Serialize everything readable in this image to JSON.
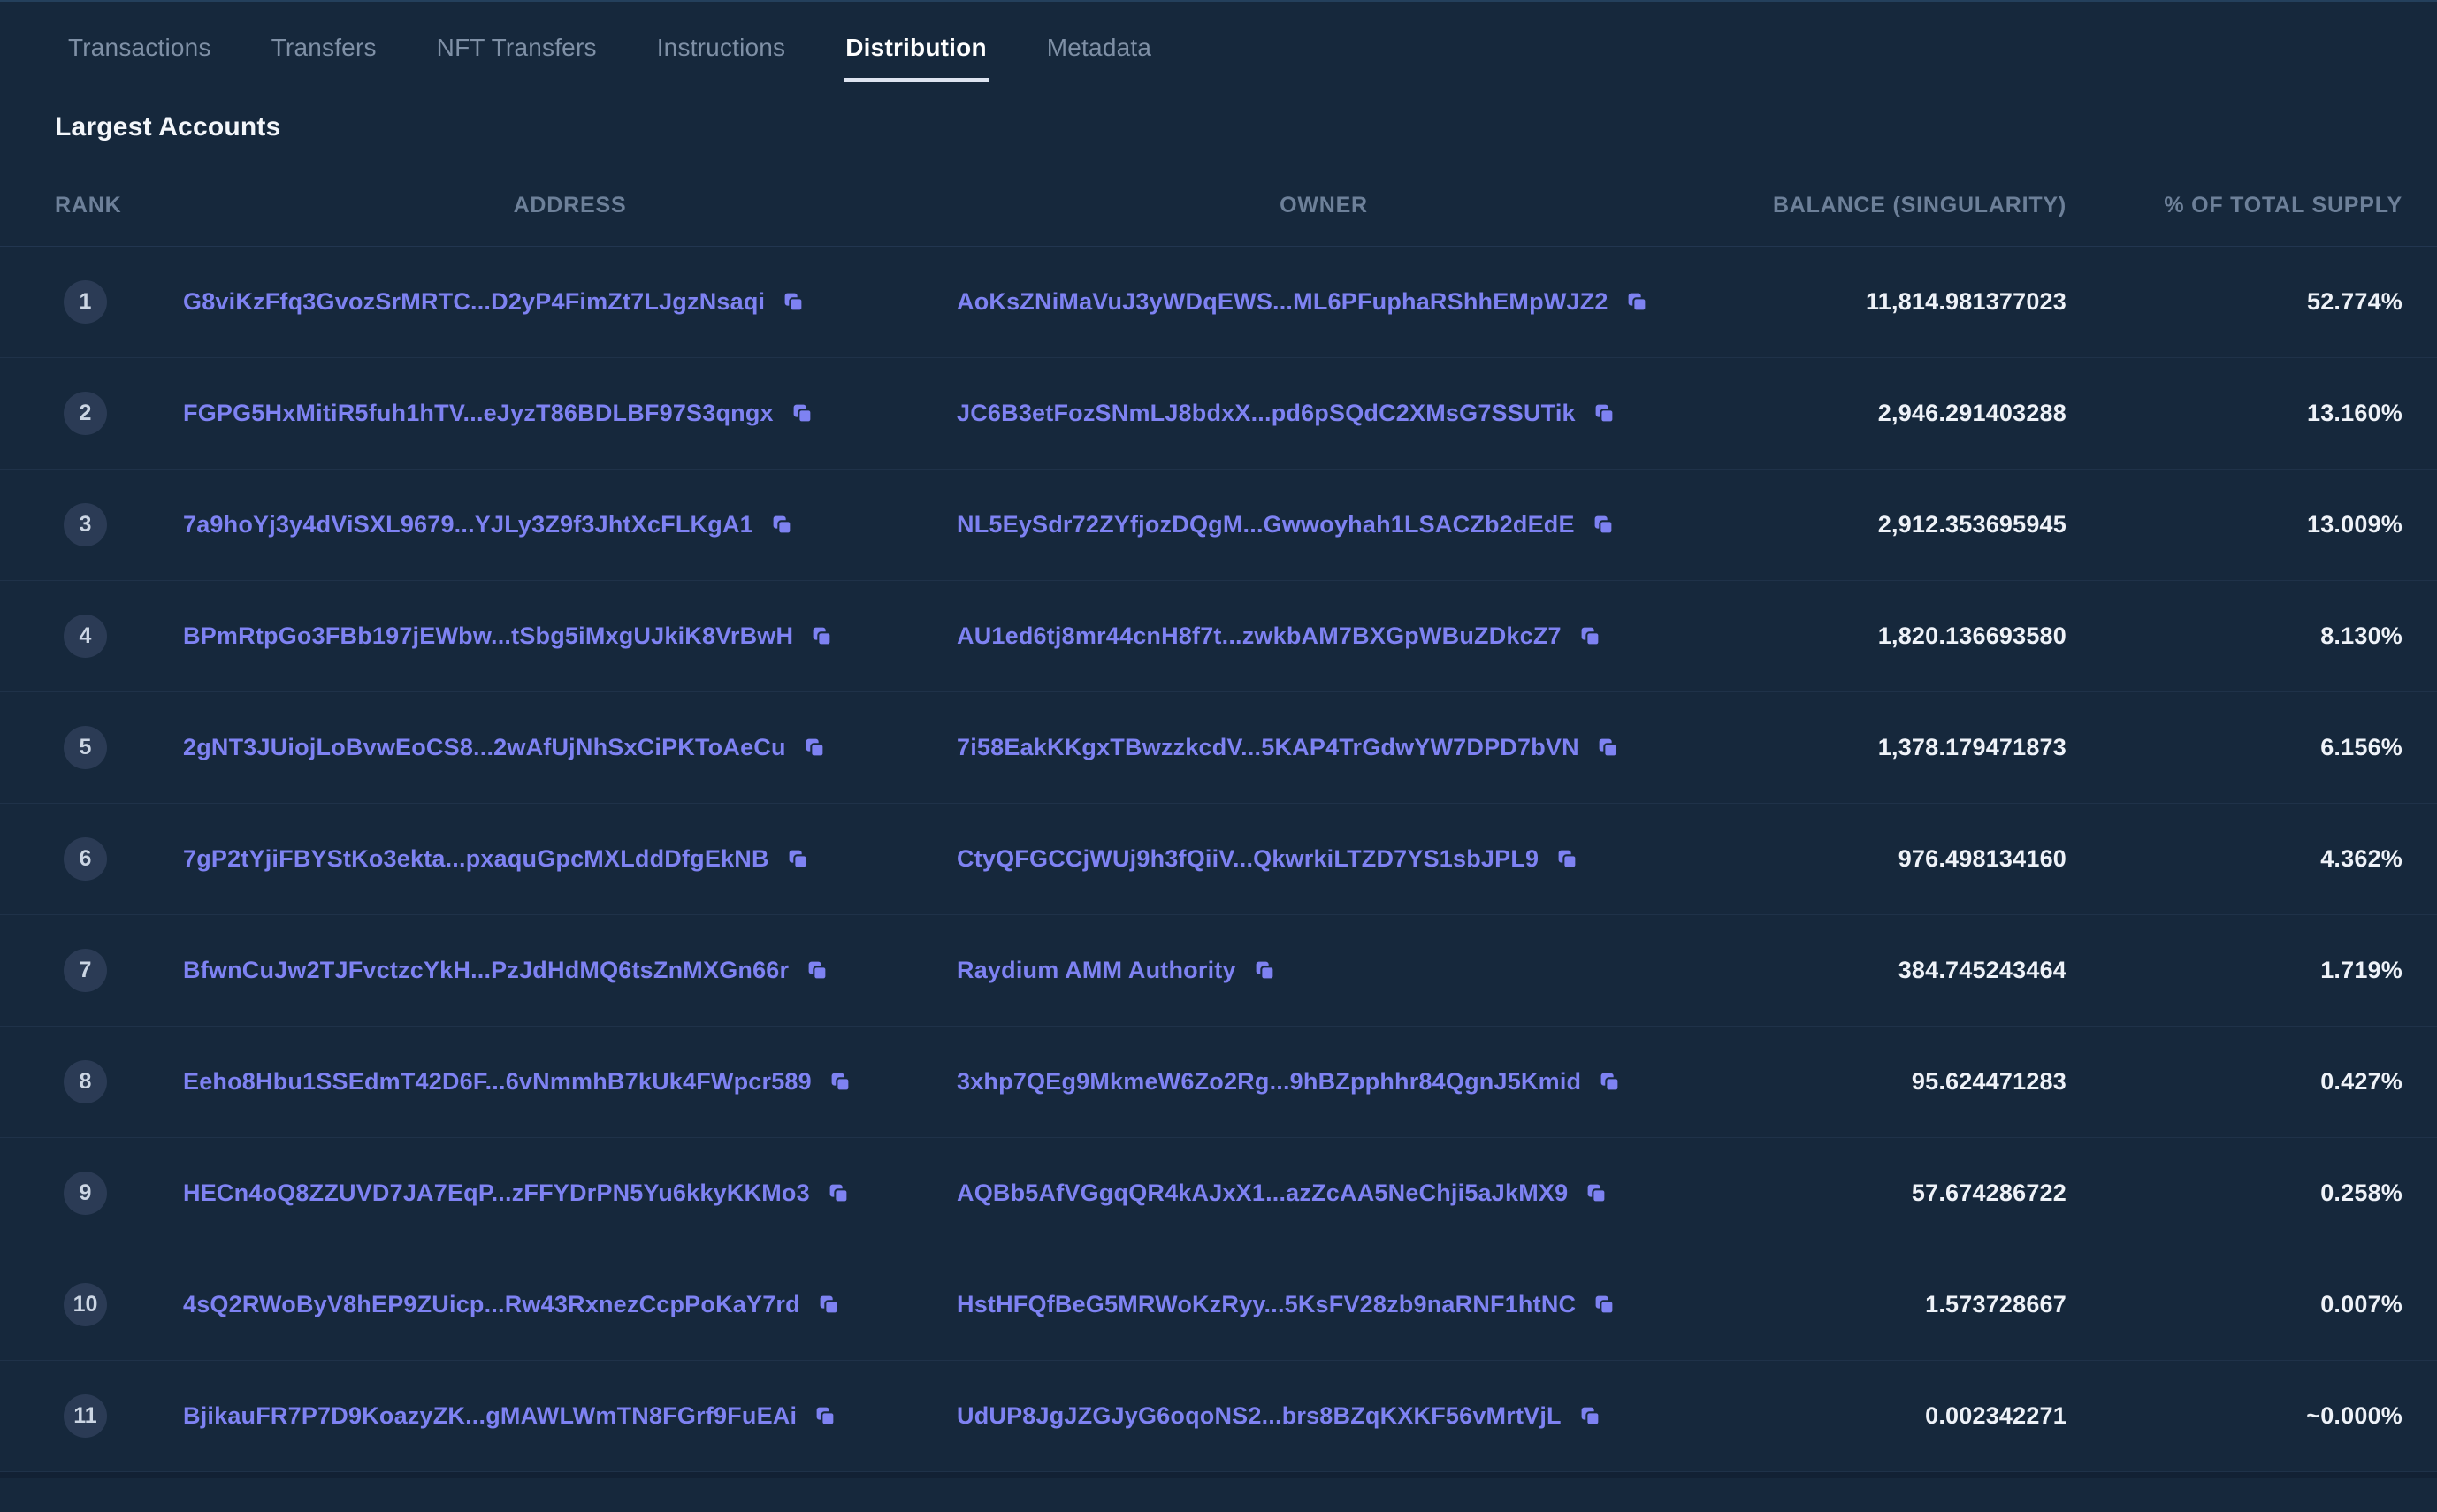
{
  "colors": {
    "bg": "#16283c",
    "accent": "#7e82f2",
    "row_separator": "#1f3249",
    "active_tab_underline": "#dde4f0"
  },
  "tabs": [
    {
      "label": "Transactions",
      "active": false
    },
    {
      "label": "Transfers",
      "active": false
    },
    {
      "label": "NFT Transfers",
      "active": false
    },
    {
      "label": "Instructions",
      "active": false
    },
    {
      "label": "Distribution",
      "active": true
    },
    {
      "label": "Metadata",
      "active": false
    }
  ],
  "section_title": "Largest Accounts",
  "icons": {
    "copy": "copy-icon"
  },
  "table": {
    "headers": {
      "rank": "RANK",
      "address": "ADDRESS",
      "owner": "OWNER",
      "balance": "BALANCE (SINGULARITY)",
      "percent": "% OF TOTAL SUPPLY"
    },
    "rows": [
      {
        "rank": "1",
        "address": "G8viKzFfq3GvozSrMRTC...D2yP4FimZt7LJgzNsaqi",
        "owner": "AoKsZNiMaVuJ3yWDqEWS...ML6PFuphaRShhEMpWJZ2",
        "balance": "11,814.981377023",
        "percent": "52.774%"
      },
      {
        "rank": "2",
        "address": "FGPG5HxMitiR5fuh1hTV...eJyzT86BDLBF97S3qngx",
        "owner": "JC6B3etFozSNmLJ8bdxX...pd6pSQdC2XMsG7SSUTik",
        "balance": "2,946.291403288",
        "percent": "13.160%"
      },
      {
        "rank": "3",
        "address": "7a9hoYj3y4dViSXL9679...YJLy3Z9f3JhtXcFLKgA1",
        "owner": "NL5EySdr72ZYfjozDQgM...Gwwoyhah1LSACZb2dEdE",
        "balance": "2,912.353695945",
        "percent": "13.009%"
      },
      {
        "rank": "4",
        "address": "BPmRtpGo3FBb197jEWbw...tSbg5iMxgUJkiK8VrBwH",
        "owner": "AU1ed6tj8mr44cnH8f7t...zwkbAM7BXGpWBuZDkcZ7",
        "balance": "1,820.136693580",
        "percent": "8.130%"
      },
      {
        "rank": "5",
        "address": "2gNT3JUiojLoBvwEoCS8...2wAfUjNhSxCiPKToAeCu",
        "owner": "7i58EakKKgxTBwzzkcdV...5KAP4TrGdwYW7DPD7bVN",
        "balance": "1,378.179471873",
        "percent": "6.156%"
      },
      {
        "rank": "6",
        "address": "7gP2tYjiFBYStKo3ekta...pxaquGpcMXLddDfgEkNB",
        "owner": "CtyQFGCCjWUj9h3fQiiV...QkwrkiLTZD7YS1sbJPL9",
        "balance": "976.498134160",
        "percent": "4.362%"
      },
      {
        "rank": "7",
        "address": "BfwnCuJw2TJFvctzcYkH...PzJdHdMQ6tsZnMXGn66r",
        "owner": "Raydium AMM Authority",
        "balance": "384.745243464",
        "percent": "1.719%"
      },
      {
        "rank": "8",
        "address": "Eeho8Hbu1SSEdmT42D6F...6vNmmhB7kUk4FWpcr589",
        "owner": "3xhp7QEg9MkmeW6Zo2Rg...9hBZpphhr84QgnJ5Kmid",
        "balance": "95.624471283",
        "percent": "0.427%"
      },
      {
        "rank": "9",
        "address": "HECn4oQ8ZZUVD7JA7EqP...zFFYDrPN5Yu6kkyKKMo3",
        "owner": "AQBb5AfVGgqQR4kAJxX1...azZcAA5NeChji5aJkMX9",
        "balance": "57.674286722",
        "percent": "0.258%"
      },
      {
        "rank": "10",
        "address": "4sQ2RWoByV8hEP9ZUicp...Rw43RxnezCcpPoKaY7rd",
        "owner": "HstHFQfBeG5MRWoKzRyy...5KsFV28zb9naRNF1htNC",
        "balance": "1.573728667",
        "percent": "0.007%"
      },
      {
        "rank": "11",
        "address": "BjikauFR7P7D9KoazyZK...gMAWLWmTN8FGrf9FuEAi",
        "owner": "UdUP8JgJZGJyG6oqoNS2...brs8BZqKXKF56vMrtVjL",
        "balance": "0.002342271",
        "percent": "~0.000%"
      }
    ]
  }
}
